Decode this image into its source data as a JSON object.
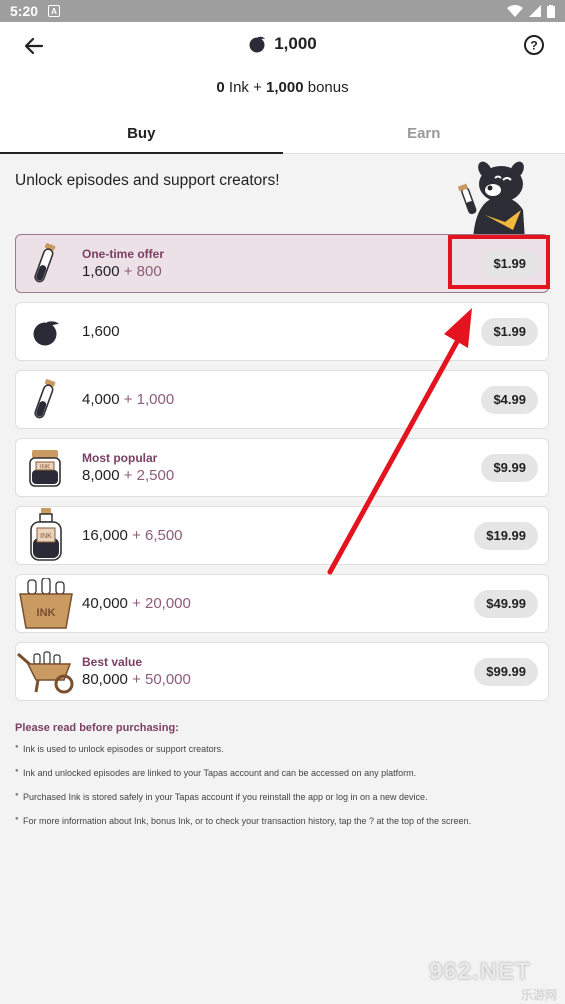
{
  "status_bar": {
    "time": "5:20",
    "notif_icon_letter": "A"
  },
  "header": {
    "ink_balance": "1,000"
  },
  "balance_line": {
    "ink": "0",
    "ink_label": " Ink + ",
    "bonus": "1,000",
    "bonus_label": " bonus"
  },
  "tabs": [
    {
      "label": "Buy",
      "active": true
    },
    {
      "label": "Earn",
      "active": false
    }
  ],
  "intro_text": "Unlock episodes and support creators!",
  "offers": [
    {
      "tag": "One-time offer",
      "base": "1,600",
      "bonus": "+ 800",
      "price": "$1.99",
      "icon": "ink-vial-icon"
    },
    {
      "tag": "",
      "base": "1,600",
      "bonus": "",
      "price": "$1.99",
      "icon": "ink-drop-icon"
    },
    {
      "tag": "",
      "base": "4,000",
      "bonus": "+ 1,000",
      "price": "$4.99",
      "icon": "ink-vial-icon"
    },
    {
      "tag": "Most popular",
      "base": "8,000",
      "bonus": "+ 2,500",
      "price": "$9.99",
      "icon": "ink-jar-icon"
    },
    {
      "tag": "",
      "base": "16,000",
      "bonus": "+ 6,500",
      "price": "$19.99",
      "icon": "ink-bottle-icon"
    },
    {
      "tag": "",
      "base": "40,000",
      "bonus": "+ 20,000",
      "price": "$49.99",
      "icon": "ink-crate-icon"
    },
    {
      "tag": "Best value",
      "base": "80,000",
      "bonus": "+ 50,000",
      "price": "$99.99",
      "icon": "ink-wheelbarrow-icon"
    }
  ],
  "notes": {
    "heading": "Please read before purchasing:",
    "items": [
      "Ink is used to unlock episodes or support creators.",
      "Ink and unlocked episodes are linked to your Tapas account and can be accessed on any platform.",
      "Purchased Ink is stored safely in your Tapas account if you reinstall the app or log in on a new device.",
      "For more information about Ink, bonus Ink, or to check your transaction history, tap the ? at the top of the screen."
    ]
  },
  "watermark": {
    "top": "962.NET",
    "bottom": "乐游网"
  },
  "colors": {
    "accent": "#7a3f62",
    "bonus": "#8e5b7a",
    "highlight_bg": "#ede1e8",
    "annotation_red": "#e3141f"
  }
}
